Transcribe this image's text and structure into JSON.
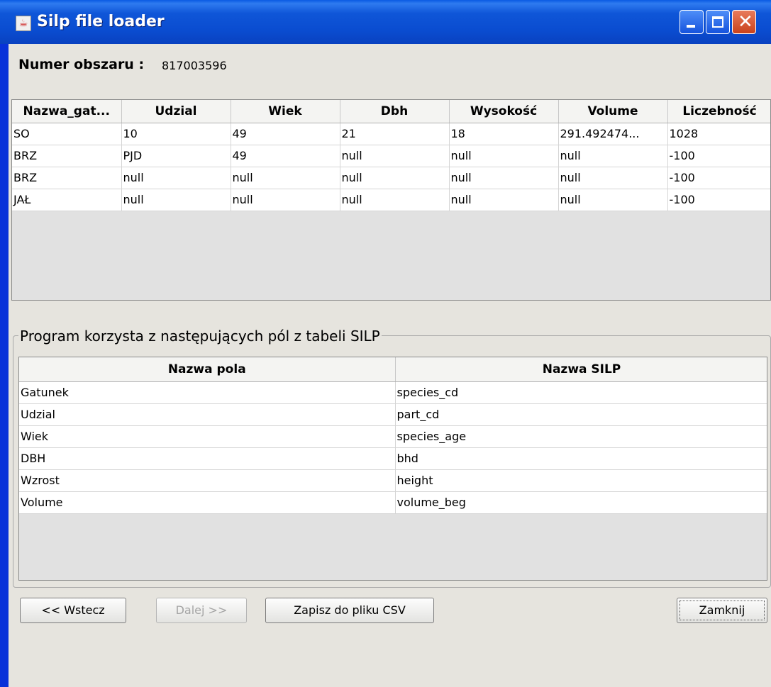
{
  "window": {
    "title": "Silp file loader"
  },
  "header": {
    "numer_label": "Numer obszaru :",
    "numer_value": "817003596"
  },
  "species_table": {
    "columns": [
      "Nazwa_gat...",
      "Udzial",
      "Wiek",
      "Dbh",
      "Wysokość",
      "Volume",
      "Liczebność"
    ],
    "rows": [
      [
        "SO",
        "10",
        "49",
        "21",
        "18",
        "291.492474...",
        "1028"
      ],
      [
        "BRZ",
        "PJD",
        "49",
        "null",
        "null",
        "null",
        "-100"
      ],
      [
        "BRZ",
        "null",
        "null",
        "null",
        "null",
        "null",
        "-100"
      ],
      [
        "JAŁ",
        "null",
        "null",
        "null",
        "null",
        "null",
        "-100"
      ]
    ]
  },
  "fields_group": {
    "title": "Program korzysta z następujących pól z tabeli SILP",
    "columns": [
      "Nazwa pola",
      "Nazwa SILP"
    ],
    "rows": [
      [
        "Gatunek",
        "species_cd"
      ],
      [
        "Udzial",
        "part_cd"
      ],
      [
        "Wiek",
        "species_age"
      ],
      [
        "DBH",
        "bhd"
      ],
      [
        "Wzrost",
        "height"
      ],
      [
        "Volume",
        "volume_beg"
      ]
    ]
  },
  "buttons": {
    "back": "<< Wstecz",
    "next": "Dalej >>",
    "save_csv": "Zapisz do pliku CSV",
    "close": "Zamknij"
  },
  "colors": {
    "titlebar": "#0a4cd0",
    "client_bg": "#e6e4de",
    "close_button": "#c9421c"
  }
}
